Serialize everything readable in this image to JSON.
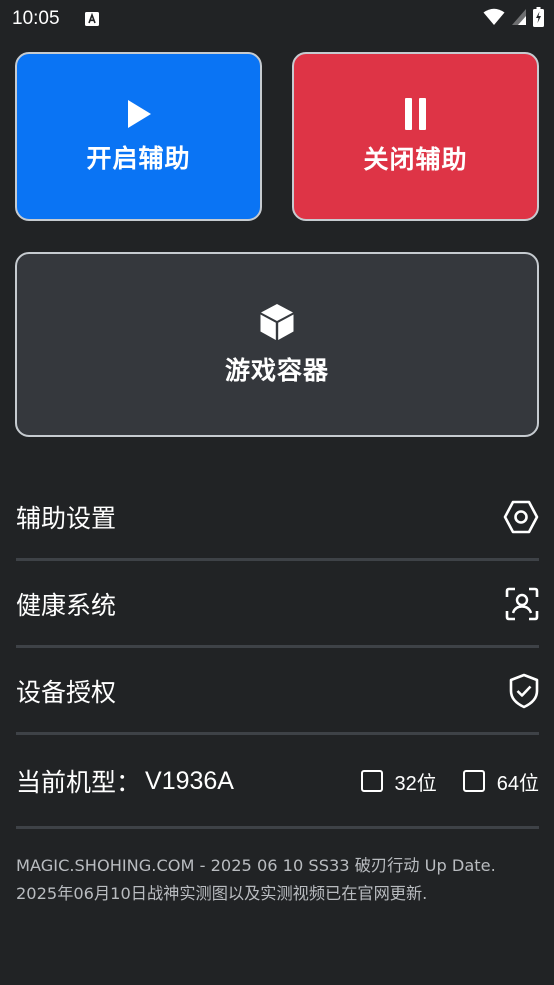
{
  "status_bar": {
    "time": "10:05",
    "notification_icon": "a-letter-notification-icon",
    "wifi_icon": "wifi-icon",
    "signal_icon": "signal-icon",
    "battery_icon": "battery-charging-icon"
  },
  "buttons": {
    "start": {
      "label": "开启辅助",
      "icon": "play-icon",
      "color": "#0a74f4"
    },
    "stop": {
      "label": "关闭辅助",
      "icon": "pause-icon",
      "color": "#de3446"
    },
    "container": {
      "label": "游戏容器",
      "icon": "cube-icon",
      "color": "#35383d"
    }
  },
  "menu": [
    {
      "label": "辅助设置",
      "icon": "settings-hexagon-icon"
    },
    {
      "label": "健康系统",
      "icon": "face-scan-icon"
    },
    {
      "label": "设备授权",
      "icon": "shield-check-icon"
    }
  ],
  "model": {
    "label": "当前机型：",
    "value": "V1936A",
    "options": [
      {
        "num": "32",
        "suffix": "位",
        "checked": false
      },
      {
        "num": "64",
        "suffix": "位",
        "checked": false
      }
    ]
  },
  "footer": {
    "line1": "MAGIC.SHOHING.COM - 2025 06 10 SS33 破刃行动 Up Date.",
    "line2": "2025年06月10日战神实测图以及实测视频已在官网更新."
  }
}
